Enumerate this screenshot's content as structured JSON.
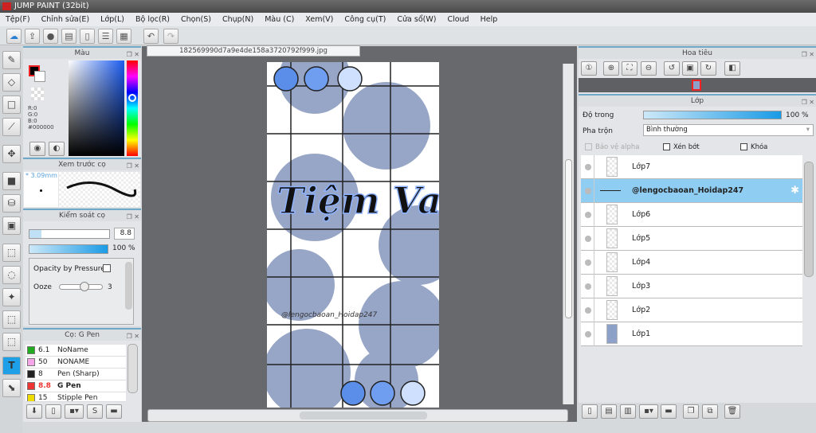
{
  "window": {
    "title": "JUMP PAINT (32bit)"
  },
  "menu": [
    "Tệp(F)",
    "Chỉnh sửa(E)",
    "Lớp(L)",
    "Bộ lọc(R)",
    "Chọn(S)",
    "Chụp(N)",
    "Màu (C)",
    "Xem(V)",
    "Công cụ(T)",
    "Cửa sổ(W)",
    "Cloud",
    "Help"
  ],
  "document": {
    "tab": "182569990d7a9e4de158a3720792f999.jpg",
    "watermark": "@lengocbaoan_Hoidap247",
    "art_title": "Tiệm Vaccine"
  },
  "color_panel": {
    "title": "Màu",
    "r": "R:0",
    "g": "G:0",
    "b": "B:0",
    "hex": "#000000",
    "fg": "#000000",
    "bg": "#ffffff"
  },
  "brush_preview": {
    "title": "Xem trước cọ",
    "size": "* 3.09mm"
  },
  "brush_control": {
    "title": "Kiểm soát cọ",
    "size_value": "8.8",
    "opacity_value": "100 %",
    "opacity_by_pressure": "Opacity by Pressure",
    "ooze_label": "Ooze",
    "ooze_value": "3"
  },
  "brush_list": {
    "title": "Cọ: G Pen",
    "items": [
      {
        "size": "6.1",
        "name": "NoName",
        "color": "#22aa22"
      },
      {
        "size": "50",
        "name": "NONAME",
        "color": "#f4a6e8"
      },
      {
        "size": "8",
        "name": "Pen (Sharp)",
        "color": "#222222"
      },
      {
        "size": "8.8",
        "name": "G Pen",
        "color": "#ee3333",
        "selected": true
      },
      {
        "size": "15",
        "name": "Stipple Pen",
        "color": "#eedd00"
      }
    ]
  },
  "navigator": {
    "title": "Hoa tiêu"
  },
  "layers": {
    "title": "Lớp",
    "opacity_label": "Độ trong",
    "opacity_value": "100 %",
    "blend_label": "Pha trộn",
    "blend_value": "Bình thường",
    "protect_alpha": "Bảo vệ alpha",
    "clip": "Xén bớt",
    "lock": "Khóa",
    "items": [
      {
        "name": "Lớp7"
      },
      {
        "name": "@lengocbaoan_Hoidap247",
        "selected": true
      },
      {
        "name": "Lớp6"
      },
      {
        "name": "Lớp5"
      },
      {
        "name": "Lớp4"
      },
      {
        "name": "Lớp3"
      },
      {
        "name": "Lớp2"
      },
      {
        "name": "Lớp1"
      }
    ]
  }
}
